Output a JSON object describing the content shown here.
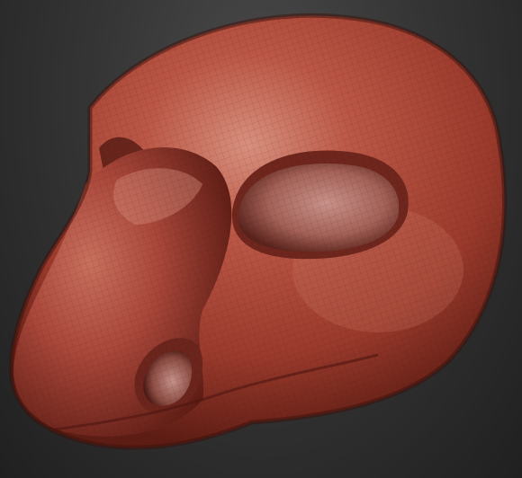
{
  "viewport": {
    "background_top": "#4a4a4a",
    "background_bottom": "#1e1e1e"
  },
  "model": {
    "subject": "sculpted-creature-head",
    "material_color": "#b04a3a",
    "material_highlight": "#d98a78",
    "material_shadow": "#5a1c14",
    "wireframe_visible": true
  }
}
